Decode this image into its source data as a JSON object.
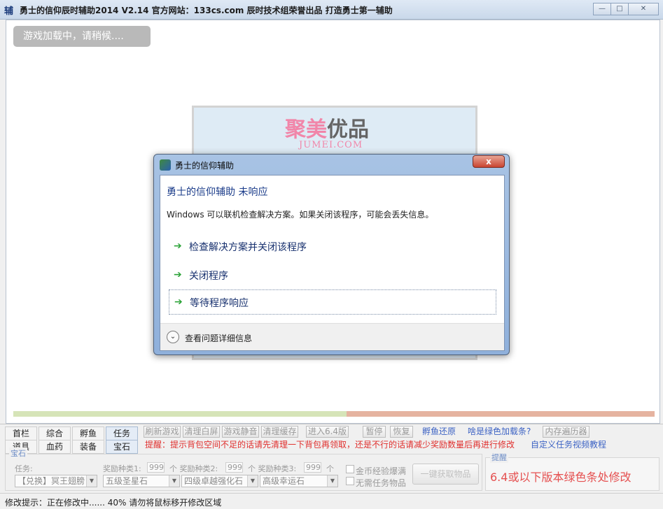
{
  "window": {
    "app_icon_glyph": "辅",
    "title": "勇士的信仰辰时辅助2014 V2.14 官方网站：133cs.com 辰时技术组荣誉出品   打造勇士第一辅助"
  },
  "loading": {
    "text": "游戏加载中，请稍候...."
  },
  "banner": {
    "logo_pink": "聚美",
    "logo_dark": "优品",
    "subtitle": "JUMEI.COM"
  },
  "dialog": {
    "title": "勇士的信仰辅助",
    "close_glyph": "x",
    "heading": "勇士的信仰辅助 未响应",
    "message": "Windows 可以联机检查解决方案。如果关闭该程序，可能会丢失信息。",
    "options": [
      {
        "label": "检查解决方案并关闭该程序"
      },
      {
        "label": "关闭程序"
      },
      {
        "label": "等待程序响应"
      }
    ],
    "details": "查看问题详细信息"
  },
  "nav": {
    "row1": [
      "首栏",
      "综合",
      "孵鱼",
      "任务"
    ],
    "row2": [
      "道具",
      "血药",
      "装备",
      "宝石"
    ]
  },
  "actions": {
    "refresh": "刷新游戏",
    "clear_screen": "清理白屏",
    "mute": "游戏静音",
    "clear_cache": "清理缓存",
    "enter_64": "进入6.4版",
    "pause": "暂停",
    "resume": "恢复",
    "hatch_restore": "孵鱼还原",
    "green_bar": "啥是绿色加载条?",
    "mem_tool": "内存遍历器"
  },
  "hint": {
    "text": "提醒：提示背包空间不足的话请先清理一下背包再领取，还是不行的话请减少奖励数量后再进行修改",
    "video_link": "自定义任务视频教程"
  },
  "gem_group": {
    "label": "宝石",
    "task_label": "任务:",
    "reward1_label": "奖励种类1:",
    "reward1_value": "999",
    "reward2_label": "个 奖励种类2:",
    "reward2_value": "999",
    "reward3_label": "个 奖励种类3:",
    "reward3_value": "999",
    "unit": "个",
    "task_select": "【兑换】冥王翅膀",
    "reward1_select": "五级圣星石",
    "reward2_select": "四级卓越强化石",
    "reward3_select": "高级幸运石",
    "chk_gold": "金币经验爆满",
    "chk_no_item": "无需任务物品",
    "apply_button": "一键获取物品"
  },
  "tip": {
    "label": "提醒",
    "text": "6.4或以下版本绿色条处修改"
  },
  "status": {
    "text": "修改提示：正在修改中......    40%   请勿将鼠标移开修改区域"
  }
}
